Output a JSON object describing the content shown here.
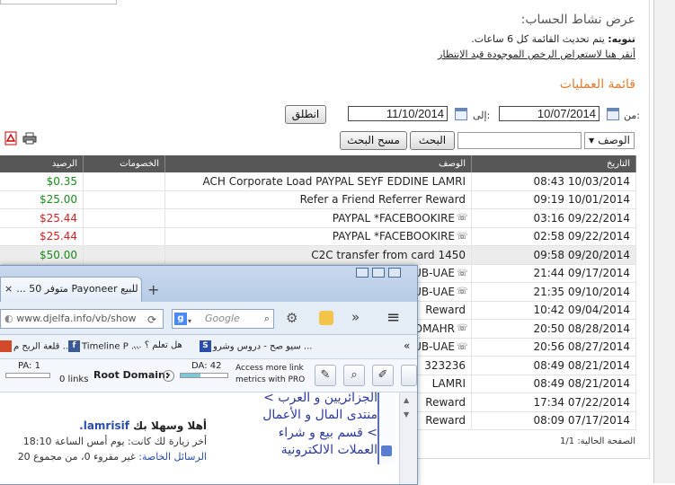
{
  "header": {
    "account_activity_title": "عرض نشاط الحساب:",
    "note_label": "تنويه:",
    "note_text": "يتم تحديث القائمة كل 6 ساعات.",
    "pending_link": "أنقر هنا لاستعراض الرخص الموجودة قيد الإنتظار"
  },
  "operations_title": "قائمة العمليات",
  "filters": {
    "from_label": "من:",
    "from_date": "10/07/2014",
    "to_label": "إلى:",
    "to_date": "11/10/2014",
    "go_button": "انطلق",
    "description_select": "الوصف",
    "search_value": "",
    "search_button": "البحث",
    "clear_button": "مسح البحث"
  },
  "table": {
    "headers": {
      "date": "التاريخ",
      "description": "الوصف",
      "debits": "الخصومات",
      "balance": "الرصيد"
    },
    "rows": [
      {
        "date": "08:43 10/03/2014",
        "description": "ACH Corporate Load PAYPAL SEYF EDDINE LAMRI",
        "debit": "",
        "balance": "$0.35",
        "balance_type": "pos",
        "phone": false
      },
      {
        "date": "09:19 10/01/2014",
        "description": "Refer a Friend Referrer Reward",
        "debit": "",
        "balance": "$25.00",
        "balance_type": "pos",
        "phone": false
      },
      {
        "date": "03:16 09/22/2014",
        "description": "PAYPAL *FACEBOOKIRE",
        "debit": "",
        "balance": "$25.44",
        "balance_type": "neg",
        "phone": true
      },
      {
        "date": "02:58 09/22/2014",
        "description": "PAYPAL *FACEBOOKIRE",
        "debit": "",
        "balance": "$25.44",
        "balance_type": "neg",
        "phone": true
      },
      {
        "date": "09:58 09/20/2014",
        "description": "C2C transfer from card 1450",
        "debit": "",
        "balance": "$50.00",
        "balance_type": "pos",
        "phone": false
      },
      {
        "date": "21:44 09/17/2014",
        "description": "UB-UAE",
        "debit": "",
        "balance": "",
        "balance_type": "",
        "phone": true
      },
      {
        "date": "21:35 09/10/2014",
        "description": "UB-UAE",
        "debit": "",
        "balance": "",
        "balance_type": "",
        "phone": true
      },
      {
        "date": "10:42 09/04/2014",
        "description": "Reward",
        "debit": "",
        "balance": "",
        "balance_type": "",
        "phone": false
      },
      {
        "date": "20:50 08/28/2014",
        "description": "OMAHR",
        "debit": "",
        "balance": "",
        "balance_type": "",
        "phone": true
      },
      {
        "date": "20:56 08/27/2014",
        "description": "UB-UAE",
        "debit": "",
        "balance": "",
        "balance_type": "",
        "phone": true
      },
      {
        "date": "08:49 08/21/2014",
        "description": "323236",
        "debit": "",
        "balance": "",
        "balance_type": "",
        "phone": false
      },
      {
        "date": "08:49 08/21/2014",
        "description": "LAMRI",
        "debit": "",
        "balance": "",
        "balance_type": "",
        "phone": false
      },
      {
        "date": "17:34 07/22/2014",
        "description": "Reward",
        "debit": "",
        "balance": "",
        "balance_type": "",
        "phone": false
      },
      {
        "date": "08:09 07/17/2014",
        "description": "Reward",
        "debit": "",
        "balance": "",
        "balance_type": "",
        "phone": false
      }
    ]
  },
  "footer": {
    "current_page_label": "الصفحة الحالية:",
    "current_page": "1/1"
  },
  "browser": {
    "tab_title": "للبيع Payoneer متوفر 50 ...",
    "new_tab": "+",
    "url": "www.djelfa.info/vb/show",
    "search_placeholder": "Google",
    "bookmarks": [
      {
        "label": "قلعة الربح م ...",
        "icon_color": "#d24a2a"
      },
      {
        "label": "Timeline P ...",
        "icon_color": "#3b5998"
      },
      {
        "label": "هل تعلم ؟ ...",
        "icon_color": "#2a4ea8"
      },
      {
        "label": "سيو صح - دروس وشرو ...",
        "icon_color": "#2a4ea8"
      }
    ],
    "moz": {
      "pa_label": "PA: 1",
      "links_label": "0 links",
      "root_domain_label": "Root Domain:",
      "da_label": "DA: 42",
      "pro_text_1": "Access more link",
      "pro_text_2": "metrics with PRO"
    },
    "page": {
      "welcome_prefix": "أهلا وسهلا بك",
      "username": "lamrisif.",
      "last_visit": "أخر زيارة لك كانت: يوم أمس الساعة 18:10",
      "private_label": "الرسائل الخاصة:",
      "private_text": "غير مقروء 0، من مجموع 20",
      "forum_lines": [
        "الجزائريين و العرب >",
        "منتدى المال و الأعمال",
        "> قسم بيع و شراء",
        "العملات الالكترونية"
      ]
    }
  }
}
